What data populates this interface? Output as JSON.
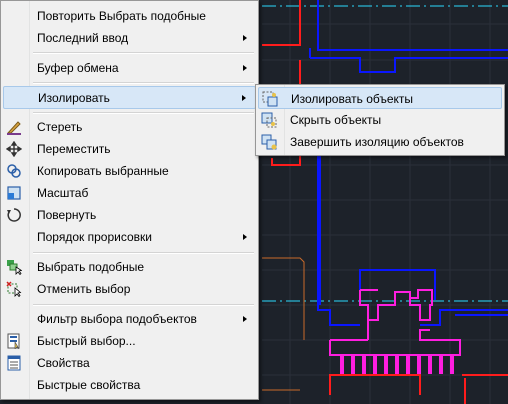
{
  "context_menu": {
    "items": [
      {
        "label": "Повторить Выбрать подобные",
        "icon": "none"
      },
      {
        "label": "Последний ввод",
        "icon": "none",
        "submenu": true
      },
      {
        "label": "Буфер обмена",
        "icon": "none",
        "submenu": true
      },
      {
        "label": "Изолировать",
        "icon": "none",
        "submenu": true,
        "highlighted": true
      },
      {
        "label": "Стереть",
        "icon": "eraser-icon"
      },
      {
        "label": "Переместить",
        "icon": "move-icon"
      },
      {
        "label": "Копировать выбранные",
        "icon": "copy-selection-icon"
      },
      {
        "label": "Масштаб",
        "icon": "scale-icon"
      },
      {
        "label": "Повернуть",
        "icon": "rotate-icon"
      },
      {
        "label": "Порядок прорисовки",
        "icon": "none",
        "submenu": true
      },
      {
        "label": "Выбрать подобные",
        "icon": "select-similar-icon"
      },
      {
        "label": "Отменить выбор",
        "icon": "deselect-icon"
      },
      {
        "label": "Фильтр выбора подобъектов",
        "icon": "none",
        "submenu": true
      },
      {
        "label": "Быстрый выбор...",
        "icon": "quick-select-icon"
      },
      {
        "label": "Свойства",
        "icon": "properties-icon"
      },
      {
        "label": "Быстрые свойства",
        "icon": "none"
      }
    ]
  },
  "submenu": {
    "items": [
      {
        "label": "Изолировать объекты",
        "icon": "isolate-objects-icon",
        "highlighted": true
      },
      {
        "label": "Скрыть объекты",
        "icon": "hide-objects-icon"
      },
      {
        "label": "Завершить изоляцию объектов",
        "icon": "end-isolation-icon"
      }
    ]
  },
  "colors": {
    "canvas_background": "#1d222a",
    "drawing_blue": "#0a16ff",
    "drawing_magenta": "#ff1ee0",
    "drawing_red": "#ff1c1c",
    "centerline_cyan": "#2ad9ff",
    "menu_background": "#f0f0f0",
    "highlight": "#d7e7f7"
  }
}
